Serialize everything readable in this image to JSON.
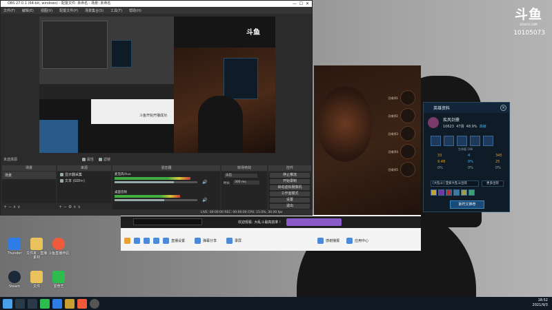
{
  "brand": {
    "logo": "斗鱼",
    "site": "DOUYU.COM",
    "room_id": "10105073"
  },
  "obs": {
    "title": "OBS 27.0.1 (64-bit, windows) - 配置文件: 未命名 - 场景: 未命名",
    "menu": [
      "文件(F)",
      "编辑(E)",
      "视图(V)",
      "配置文件(P)",
      "场景集合(S)",
      "工具(T)",
      "帮助(H)"
    ],
    "source_bar": {
      "no_source": "未选择源",
      "properties": "属性",
      "filters": "滤镜"
    },
    "scenes": {
      "header": "场景",
      "items": [
        "场景"
      ]
    },
    "sources": {
      "header": "来源",
      "items": [
        "显示器采集",
        "文本 (GDI+)"
      ]
    },
    "mixer": {
      "header": "混音器",
      "channels": [
        {
          "name": "麦克风/Aux",
          "level": 0.72
        },
        {
          "name": "桌面音频",
          "level": 0.6
        }
      ]
    },
    "transitions": {
      "header": "转场特效",
      "type": "淡出",
      "duration_label": "时长",
      "duration": "300 ms"
    },
    "controls": {
      "header": "控件",
      "buttons": [
        "停止推流",
        "开始录制",
        "启动虚拟摄像机",
        "工作室模式",
        "设置",
        "退出"
      ]
    },
    "status": "LIVE: 00:00:00   REC: 00:00:00   CPU: 15.0%, 30.00 fps"
  },
  "nested_popup": "斗鱼开始开播成功",
  "game_slots": [
    {
      "label": "召唤师1"
    },
    {
      "label": "召唤师2"
    },
    {
      "label": "召唤师3"
    },
    {
      "label": "召唤师4"
    },
    {
      "label": "召唤师5"
    }
  ],
  "hero_panel": {
    "title": "英雄资料",
    "name": "疾风剑豪",
    "stats": [
      "10623",
      "47场",
      "48.9%"
    ],
    "tag": "高级",
    "mode": "[大乱斗] 亚索大乱斗出装",
    "select": "更多出装",
    "button": "斯符文推荐",
    "numbers": [
      "33",
      "4",
      "345",
      "9.4B",
      "0%",
      "25",
      "0%",
      "0%",
      "0%"
    ],
    "skill_label": "生命值 108"
  },
  "chat": {
    "row1_text": "欢迎观看: 大乱斗最高前率 !",
    "items": [
      {
        "label": "直播设置",
        "icon": "broadcast-icon"
      },
      {
        "label": "弹幕分享",
        "icon": "share-icon"
      },
      {
        "label": "录屏",
        "icon": "record-icon"
      },
      {
        "label": "感谢播报",
        "icon": "thanks-icon"
      },
      {
        "label": "应用中心",
        "icon": "app-icon"
      }
    ]
  },
  "desktop_icons": [
    {
      "label": "Thunder",
      "color": "#2f7ee8"
    },
    {
      "label": "文件夹 - 直播素材",
      "color": "#e8c25a"
    },
    {
      "label": "斗鱼直播伴侣",
      "color": "#f05a3a"
    },
    {
      "label": "Steam",
      "color": "#1b2838"
    },
    {
      "label": "文件",
      "color": "#e8c25a"
    },
    {
      "label": "爱奇艺",
      "color": "#2ebc4f"
    }
  ],
  "taskbar": {
    "time": "18:52",
    "date": "2021/9/3"
  },
  "colors": {
    "obs_bg": "#2b2b2b",
    "accent_green": "#3fae3f",
    "hero_bg": "#0f1b26"
  }
}
